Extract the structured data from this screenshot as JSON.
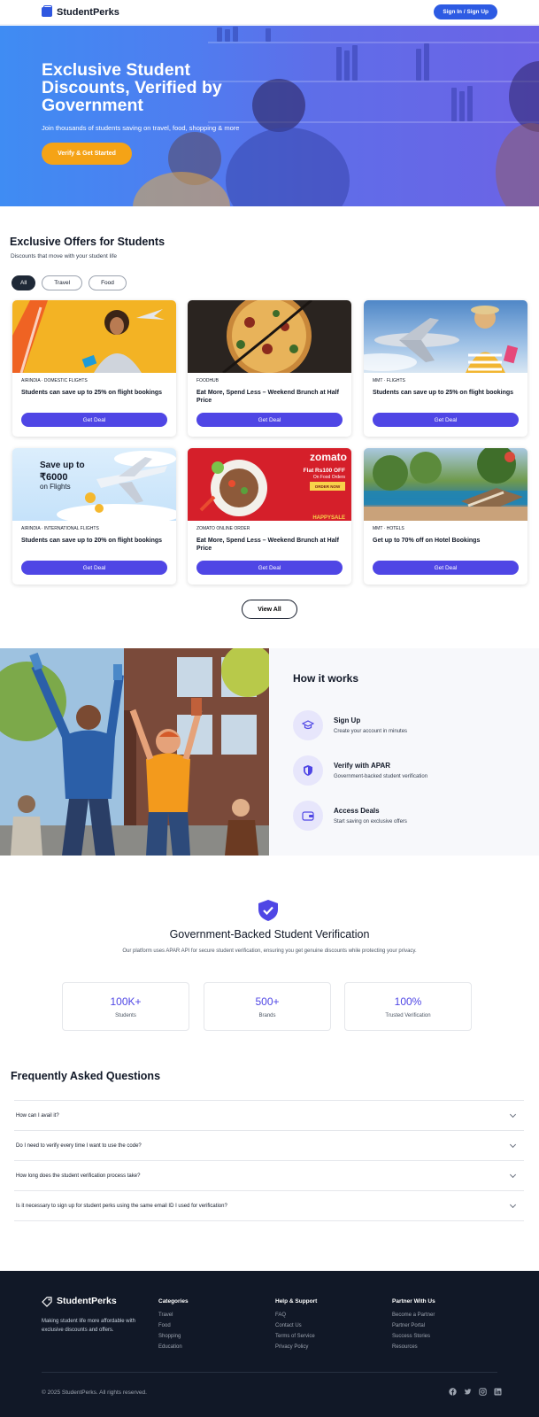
{
  "header": {
    "brand": "StudentPerks",
    "signin_label": "Sign In / Sign Up"
  },
  "hero": {
    "title": "Exclusive Student Discounts, Verified by Government",
    "subtitle": "Join thousands of students saving on travel, food, shopping & more",
    "cta_label": "Verify & Get Started"
  },
  "offers": {
    "title": "Exclusive Offers for Students",
    "subtitle": "Discounts that move with your student life",
    "filters": [
      "All",
      "Travel",
      "Food"
    ],
    "active_filter": "All",
    "cards": [
      {
        "tag": "AIRINDIA · DOMESTIC FLIGHTS",
        "title": "Students can save up to 25% on flight bookings",
        "button": "Get Deal"
      },
      {
        "tag": "FOODHUB",
        "title": "Eat More, Spend Less – Weekend Brunch at Half Price",
        "button": "Get Deal"
      },
      {
        "tag": "MMT · FLIGHTS",
        "title": "Students can save up to 25% on flight bookings",
        "button": "Get Deal"
      },
      {
        "tag": "AIRINDIA · INTERNATIONAL FLIGHTS",
        "title": "Students can save up to 20% on flight bookings",
        "button": "Get Deal"
      },
      {
        "tag": "ZOMATO ONLINE ORDER",
        "title": "Eat More, Spend Less – Weekend Brunch at Half Price",
        "button": "Get Deal"
      },
      {
        "tag": "MMT · HOTELS",
        "title": "Get up to 70% off on Hotel Bookings",
        "button": "Get Deal"
      }
    ],
    "promo_flight": {
      "line1": "Save up to",
      "line2": "₹6000",
      "line3": "on Flights"
    },
    "promo_zomato": {
      "brand": "zomato",
      "line1": "Flat Rs100 OFF",
      "line2": "On Food Orders",
      "cta": "ORDER NOW",
      "footer": "HAPPYSALE"
    },
    "view_all_label": "View All"
  },
  "how_it_works": {
    "title": "How it works",
    "steps": [
      {
        "title": "Sign Up",
        "desc": "Create your account in minutes",
        "icon": "graduation-cap-icon"
      },
      {
        "title": "Verify with APAR",
        "desc": "Government-backed student verification",
        "icon": "shield-icon"
      },
      {
        "title": "Access Deals",
        "desc": "Start saving on exclusive offers",
        "icon": "wallet-icon"
      }
    ]
  },
  "verification": {
    "title": "Government-Backed Student Verification",
    "subtitle": "Our platform uses APAR API for secure student verification, ensuring you get genuine discounts while protecting your privacy.",
    "stats": [
      {
        "value": "100K+",
        "label": "Students"
      },
      {
        "value": "500+",
        "label": "Brands"
      },
      {
        "value": "100%",
        "label": "Trusted Verification"
      }
    ]
  },
  "faq": {
    "title": "Frequently Asked Questions",
    "items": [
      "How can I avail it?",
      "Do I need to verify every time I want to use the code?",
      "How long does the student verification process take?",
      "Is it necessary to sign up for student perks using the same email ID I used for verification?"
    ]
  },
  "footer": {
    "brand": "StudentPerks",
    "tagline": "Making student life more affordable with exclusive discounts and offers.",
    "columns": [
      {
        "title": "Categories",
        "links": [
          "Travel",
          "Food",
          "Shopping",
          "Education"
        ]
      },
      {
        "title": "Help & Support",
        "links": [
          "FAQ",
          "Contact Us",
          "Terms of Service",
          "Privacy Policy"
        ]
      },
      {
        "title": "Partner With Us",
        "links": [
          "Become a Partner",
          "Partner Portal",
          "Success Stories",
          "Resources"
        ]
      }
    ],
    "copyright": "© 2025 StudentPerks. All rights reserved.",
    "socials": [
      "facebook-icon",
      "twitter-icon",
      "instagram-icon",
      "linkedin-icon"
    ]
  },
  "colors": {
    "primary": "#4f46e5",
    "header_button": "#2d5be3",
    "hero_cta": "#f5a316",
    "footer_bg": "#111827"
  }
}
